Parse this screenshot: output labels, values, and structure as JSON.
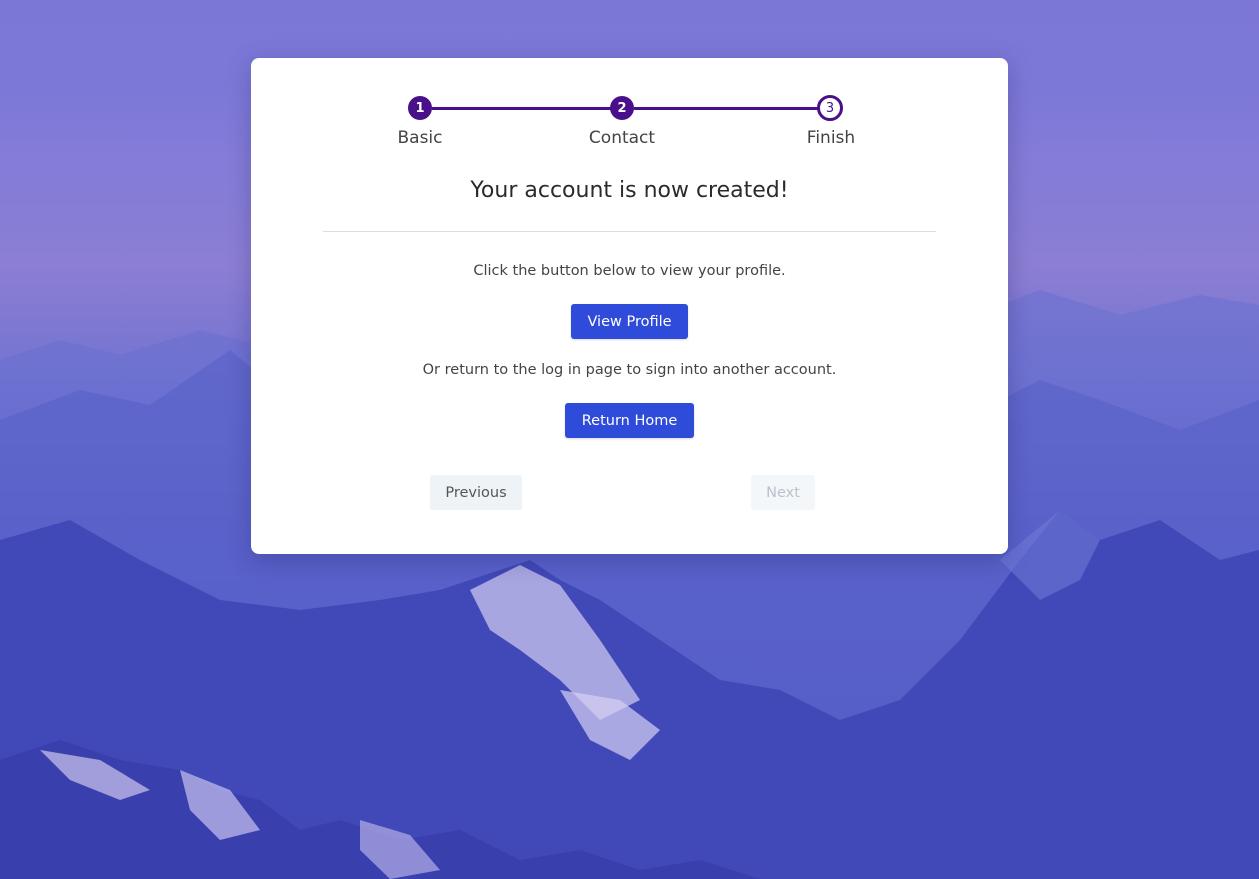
{
  "stepper": {
    "steps": [
      {
        "number": "1",
        "label": "Basic",
        "state": "complete"
      },
      {
        "number": "2",
        "label": "Contact",
        "state": "complete"
      },
      {
        "number": "3",
        "label": "Finish",
        "state": "current"
      }
    ],
    "accent_color": "#4a0f8a"
  },
  "main": {
    "title": "Your account is now created!",
    "profile_message": "Click the button below to view your profile.",
    "view_profile_label": "View Profile",
    "return_message": "Or return to the log in page to sign into another account.",
    "return_home_label": "Return Home"
  },
  "nav": {
    "previous_label": "Previous",
    "next_label": "Next",
    "next_disabled": true
  },
  "colors": {
    "primary_button": "#2f4bd9"
  }
}
